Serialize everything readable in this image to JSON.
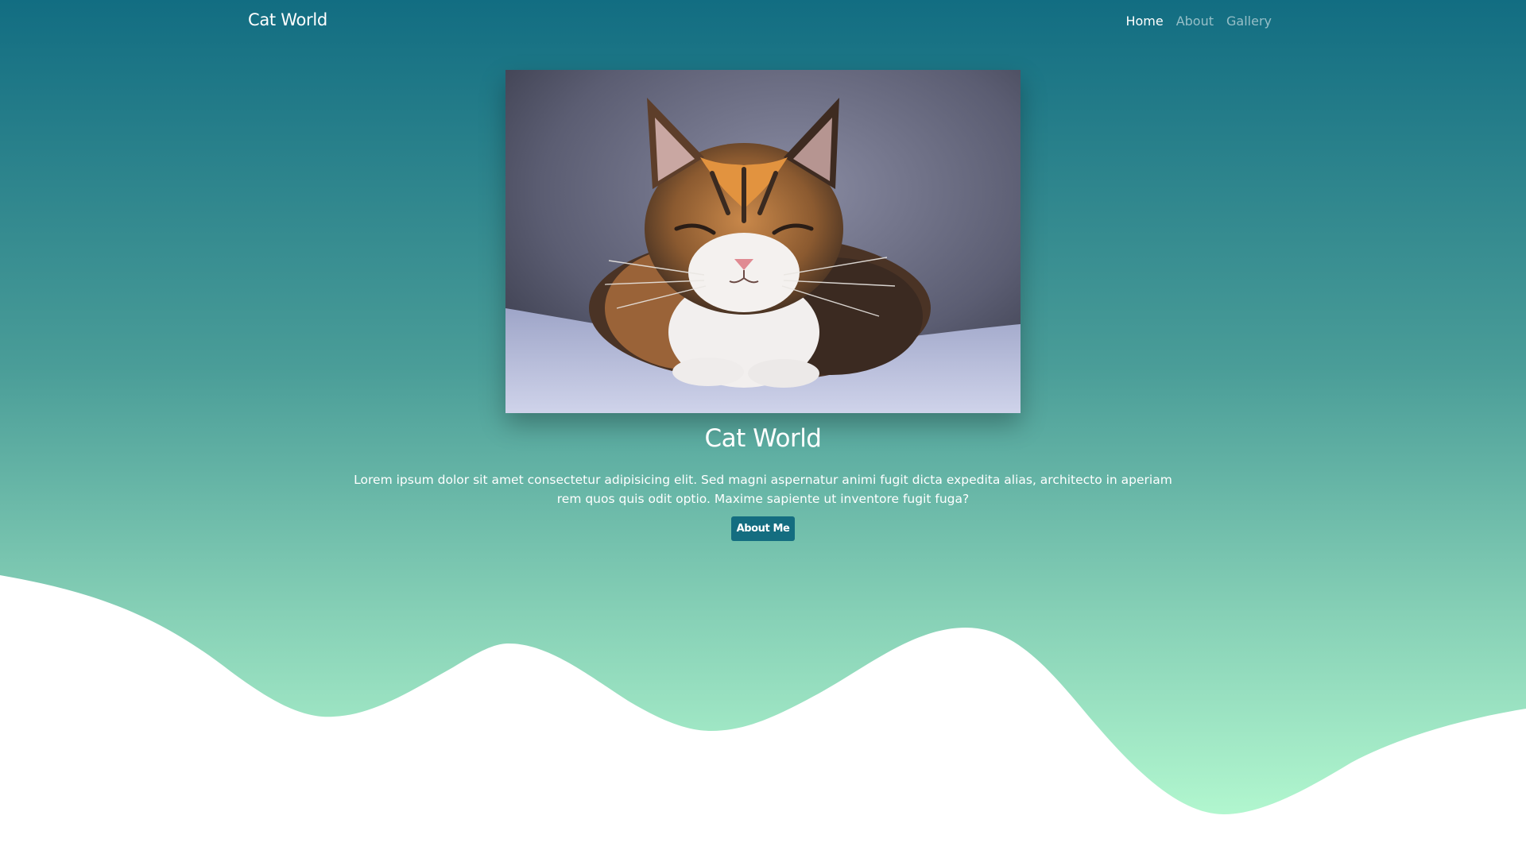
{
  "navbar": {
    "brand": "Cat World",
    "links": [
      {
        "label": "Home",
        "active": true
      },
      {
        "label": "About",
        "active": false
      },
      {
        "label": "Gallery",
        "active": false
      }
    ]
  },
  "hero": {
    "image_alt": "Calico cat resting on a blanket with eyes closed",
    "title": "Cat World",
    "text": "Lorem ipsum dolor sit amet consectetur adipisicing elit. Sed magni aspernatur animi fugit dicta expedita alias, architecto in aperiam rem quos quis odit optio. Maxime sapiente ut inventore fugit fuga?",
    "button_label": "About Me"
  },
  "colors": {
    "gradient_top": "#126d82",
    "gradient_bottom": "#b2f7cf",
    "button": "#146d80",
    "wave_fill": "#ffffff"
  }
}
